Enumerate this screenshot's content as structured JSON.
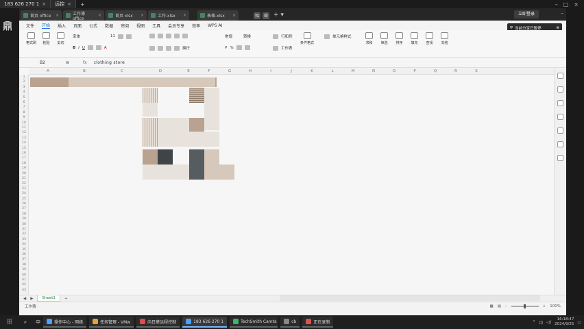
{
  "remote": {
    "tab_label": "183 626 270 1",
    "tab_extra": "远控",
    "add_icon": "plus-icon"
  },
  "desktop": {
    "logo_char": "鼎"
  },
  "tabs": {
    "items": [
      {
        "label": "首页 office"
      },
      {
        "label": "工作簿 office"
      },
      {
        "label": "首页 xlsx"
      },
      {
        "label": "工作.xlsx"
      },
      {
        "label": "表格.xlsx",
        "active": true
      }
    ],
    "login": "立即登录"
  },
  "menu": {
    "items": [
      "文件",
      "开始",
      "插入",
      "页面",
      "公式",
      "数据",
      "审阅",
      "视图",
      "工具",
      "会员专享",
      "效率",
      "WPS AI"
    ],
    "active_index": 1
  },
  "tip": {
    "text": "当前分享已暂停"
  },
  "ribbon": {
    "groups": [
      "格式刷",
      "粘贴",
      "剪切",
      "复制"
    ],
    "font_name": "宋体",
    "font_size": "11",
    "wrap": "换行",
    "number_format": "常规",
    "convert": "转换",
    "row_col": "行和列",
    "worksheet": "工作表",
    "cond_format": "条件格式",
    "cell_style": "单元格样式",
    "sum": "求和",
    "filter": "筛选",
    "sort": "排序",
    "fill": "填充",
    "find": "查找",
    "freeze": "冻结"
  },
  "formula_bar": {
    "name_box": "B2",
    "fx": "fx",
    "formula": "clothing store"
  },
  "sheet": {
    "columns": [
      "A",
      "B",
      "C",
      "D",
      "E",
      "F",
      "G",
      "H",
      "I",
      "J",
      "K",
      "L",
      "M",
      "N",
      "O",
      "P",
      "Q",
      "R",
      "S"
    ],
    "rows": [
      "1",
      "2",
      "3",
      "4",
      "5",
      "6",
      "7",
      "8",
      "9",
      "10",
      "11",
      "12",
      "13",
      "14",
      "15",
      "16",
      "17",
      "18",
      "19",
      "20",
      "21",
      "22",
      "23",
      "24",
      "25",
      "26",
      "27",
      "28",
      "29",
      "30",
      "31",
      "32",
      "33",
      "34",
      "35",
      "36",
      "37",
      "38",
      "39",
      "40",
      "41",
      "42",
      "43"
    ]
  },
  "sheet_tabs": {
    "tab": "Sheet1",
    "add": "+"
  },
  "status": {
    "left": "工作簿 ·",
    "zoom": "100%"
  },
  "taskbar": {
    "items": [
      {
        "label": "操作中心 - 网络",
        "color": "#4aa3ff"
      },
      {
        "label": "任务管理 - VMw",
        "color": "#e0a43a"
      },
      {
        "label": "向日葵远程控制",
        "color": "#e04b4b"
      },
      {
        "label": "183 626 270 1",
        "color": "#4aa3ff",
        "active": true
      },
      {
        "label": "TechSmith Camta",
        "color": "#3cb371"
      },
      {
        "label": "cb",
        "color": "#888"
      },
      {
        "label": "正在录制",
        "color": "#d9534f"
      }
    ],
    "ime": "中",
    "time": "16:18:47",
    "date": "2024/9/25"
  }
}
